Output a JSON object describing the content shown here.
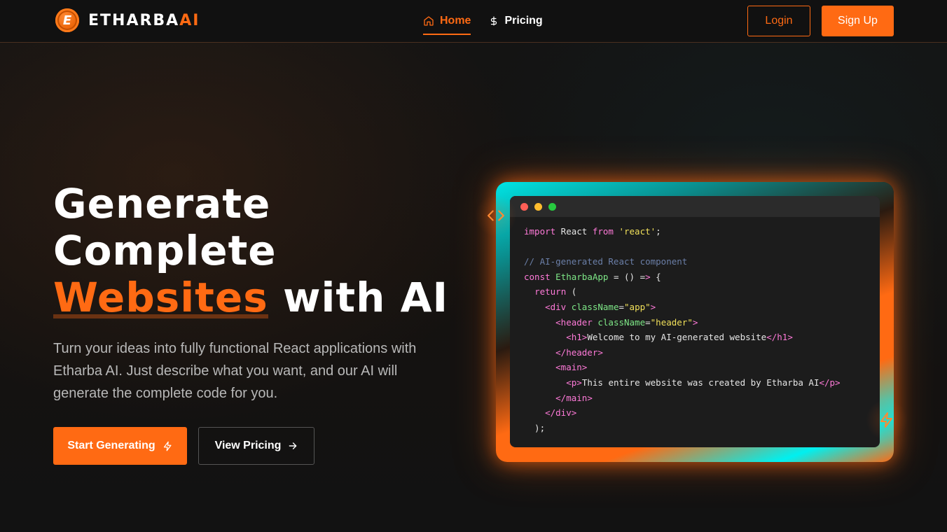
{
  "brand": {
    "name_main": "ETHARBA",
    "name_accent": "AI",
    "logo_letter": "E"
  },
  "nav": {
    "links": [
      {
        "label": "Home",
        "icon": "home-icon",
        "active": true
      },
      {
        "label": "Pricing",
        "icon": "dollar-icon",
        "active": false
      }
    ],
    "login_label": "Login",
    "signup_label": "Sign Up"
  },
  "hero": {
    "title_line1": "Generate",
    "title_line2": "Complete",
    "title_highlight": "Websites",
    "title_tail": " with AI",
    "description": "Turn your ideas into fully functional React applications with Etharba AI. Just describe what you want, and our AI will generate the complete code for you.",
    "primary_cta": "Start Generating",
    "secondary_cta": "View Pricing"
  },
  "code_preview": {
    "lines": [
      "import React from 'react';",
      "",
      "// AI-generated React component",
      "const EtharbaApp = () => {",
      "  return (",
      "    <div className=\"app\">",
      "      <header className=\"header\">",
      "        <h1>Welcome to my AI-generated website</h1>",
      "      </header>",
      "      <main>",
      "        <p>This entire website was created by Etharba AI</p>",
      "      </main>",
      "    </div>",
      "  );"
    ]
  },
  "colors": {
    "accent": "#ff6a13",
    "teal": "#00e5e5",
    "background": "#121212"
  }
}
